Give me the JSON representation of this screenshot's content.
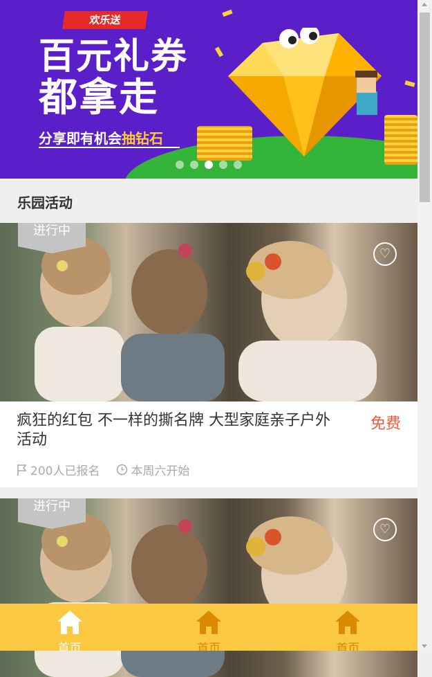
{
  "banner": {
    "ribbon": "欢乐送",
    "title_line1": "百元礼券",
    "title_line2": "都拿走",
    "subtitle_prefix": "分享即有机会",
    "subtitle_highlight": "抽钻石",
    "slides": 5,
    "active_slide": 3
  },
  "section": {
    "title": "乐园活动"
  },
  "activities": [
    {
      "status": "进行中",
      "title": "疯狂的红包 不一样的撕名牌 大型家庭亲子户外活动",
      "price": "免费",
      "signups": "200人已报名",
      "start": "本周六开始"
    },
    {
      "status": "进行中"
    }
  ],
  "tabbar": {
    "tabs": [
      {
        "label": "首页",
        "icon": "home-icon",
        "active": true
      },
      {
        "label": "首页",
        "icon": "home-icon",
        "active": false
      },
      {
        "label": "首页",
        "icon": "home-icon",
        "active": false
      }
    ]
  },
  "colors": {
    "banner_bg": "#5a1fc8",
    "price": "#f05a3c",
    "tabbar_bg": "#fbc841",
    "tab_inactive": "#d98a00",
    "status_tag": "#c4c4c4"
  }
}
